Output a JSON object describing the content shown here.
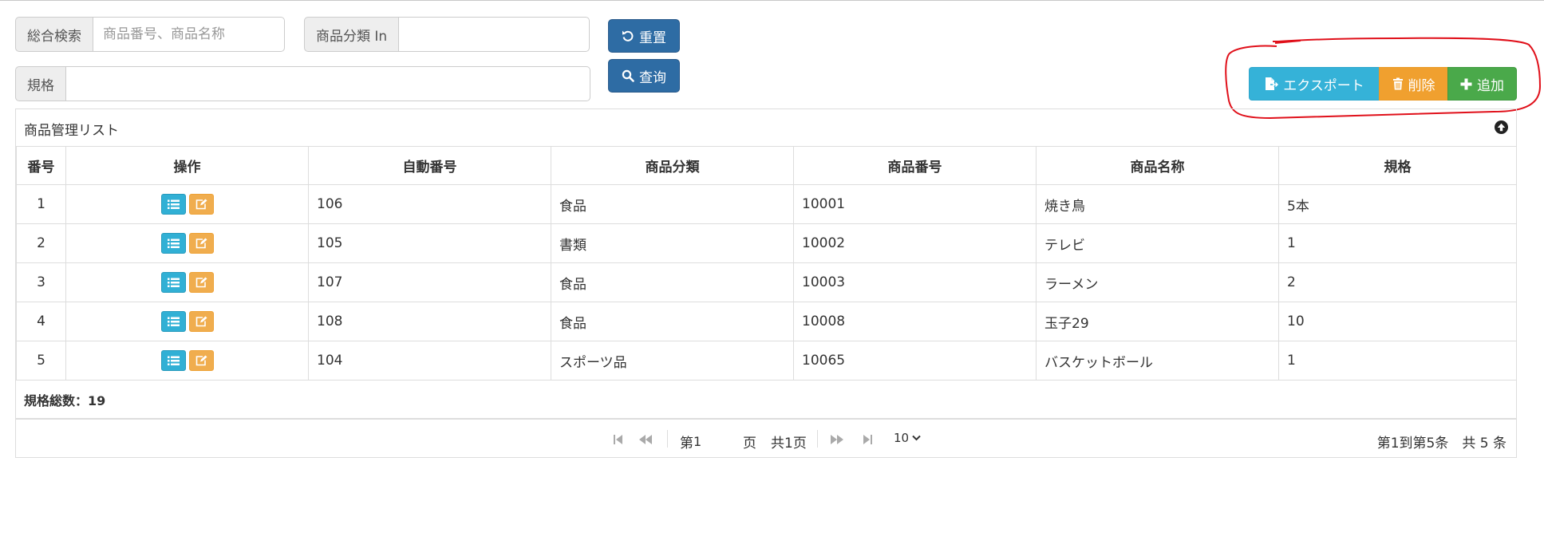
{
  "search": {
    "general_label": "総合検索",
    "general_placeholder": "商品番号、商品名称",
    "category_label": "商品分類 In",
    "category_value": "",
    "spec_label": "規格",
    "spec_value": "",
    "reset_label": "重置",
    "query_label": "查询"
  },
  "actions": {
    "export_label": "エクスポート",
    "delete_label": "削除",
    "add_label": "追加"
  },
  "panel": {
    "title": "商品管理リスト"
  },
  "table": {
    "headers": [
      "番号",
      "操作",
      "自動番号",
      "商品分類",
      "商品番号",
      "商品名称",
      "規格"
    ],
    "rows": [
      {
        "no": "1",
        "auto": "106",
        "category": "食品",
        "code": "10001",
        "name": "焼き鳥",
        "spec": "5本"
      },
      {
        "no": "2",
        "auto": "105",
        "category": "書類",
        "code": "10002",
        "name": "テレビ",
        "spec": "1"
      },
      {
        "no": "3",
        "auto": "107",
        "category": "食品",
        "code": "10003",
        "name": "ラーメン",
        "spec": "2"
      },
      {
        "no": "4",
        "auto": "108",
        "category": "食品",
        "code": "10008",
        "name": "玉子29",
        "spec": "10"
      },
      {
        "no": "5",
        "auto": "104",
        "category": "スポーツ品",
        "code": "10065",
        "name": "バスケットボール",
        "spec": "1"
      }
    ],
    "total_text": "規格総数：19"
  },
  "pager": {
    "page_prefix": "第",
    "page_value": "1",
    "page_suffix": "页",
    "total_pages": "共1页",
    "page_size": "10",
    "range_info": "第1到第5条　共 5 条"
  },
  "colors": {
    "primary": "#2e6ca4",
    "info": "#35b2d8",
    "warning": "#f0a02f",
    "success": "#4aa94a",
    "annotation": "#e0101a"
  }
}
